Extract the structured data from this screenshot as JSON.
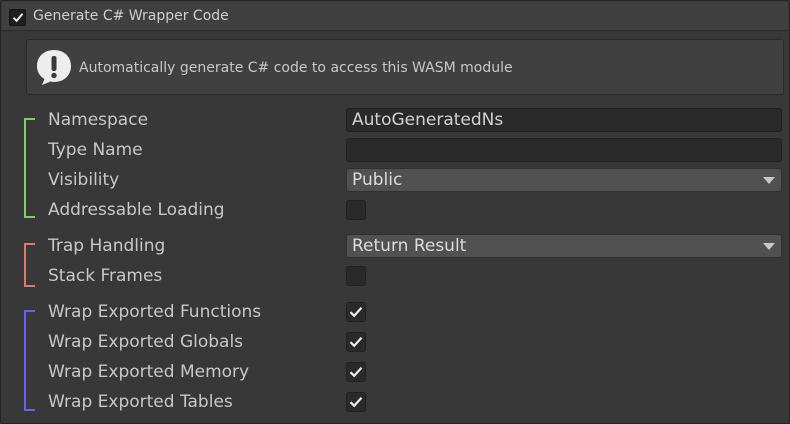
{
  "header": {
    "title": "Generate C# Wrapper Code",
    "enabled": true
  },
  "help": {
    "icon": "info-exclamation-icon",
    "text": "Automatically generate C# code to access this WASM module"
  },
  "groups": {
    "naming": {
      "color": "#7ecf67",
      "namespace_label": "Namespace",
      "namespace_value": "AutoGeneratedNs",
      "type_name_label": "Type Name",
      "type_name_value": "",
      "visibility_label": "Visibility",
      "visibility_value": "Public",
      "addressable_label": "Addressable Loading",
      "addressable_checked": false
    },
    "traps": {
      "color": "#e0796b",
      "trap_handling_label": "Trap Handling",
      "trap_handling_value": "Return Result",
      "stack_frames_label": "Stack Frames",
      "stack_frames_checked": false
    },
    "exports": {
      "color": "#6c5ef0",
      "functions_label": "Wrap Exported Functions",
      "functions_checked": true,
      "globals_label": "Wrap Exported Globals",
      "globals_checked": true,
      "memory_label": "Wrap Exported Memory",
      "memory_checked": true,
      "tables_label": "Wrap Exported Tables",
      "tables_checked": true
    }
  },
  "colors": {
    "background": "#383838",
    "header": "#404040",
    "field": "#2a2a2a",
    "dropdown": "#515151",
    "text": "#c8c8c8"
  }
}
